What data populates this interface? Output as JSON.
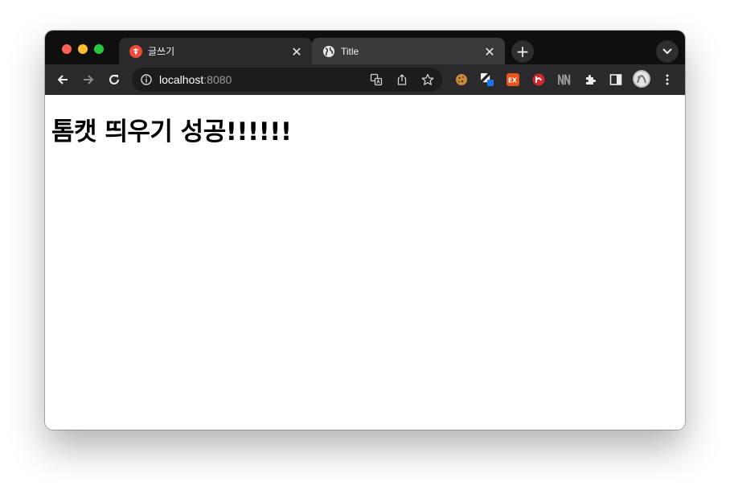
{
  "window": {
    "tabs": [
      {
        "title": "글쓰기",
        "favicon": "red-circle-logo-icon",
        "close": "✕"
      },
      {
        "title": "Title",
        "favicon": "globe-icon",
        "close": "✕"
      }
    ],
    "new_tab_symbol": "+"
  },
  "toolbar": {
    "url_host": "localhost",
    "url_port": ":8080"
  },
  "extensions": [
    "cookie-extension-icon",
    "blocked-extension-icon",
    "ex-extension-icon",
    "red-extension-icon",
    "nn-extension-icon",
    "puzzle-icon",
    "side-panel-icon",
    "profile-avatar"
  ],
  "page": {
    "heading": "톰캣 띄우기 성공!!!!!!"
  },
  "colors": {
    "tabstrip": "#0f0f10",
    "active_tab": "#3a3a3c",
    "toolbar": "#2a2a2c",
    "omnibox": "#1c1c1e",
    "close_red": "#fe5f57",
    "minimize_yellow": "#febc2e",
    "zoom_green": "#28c840"
  }
}
